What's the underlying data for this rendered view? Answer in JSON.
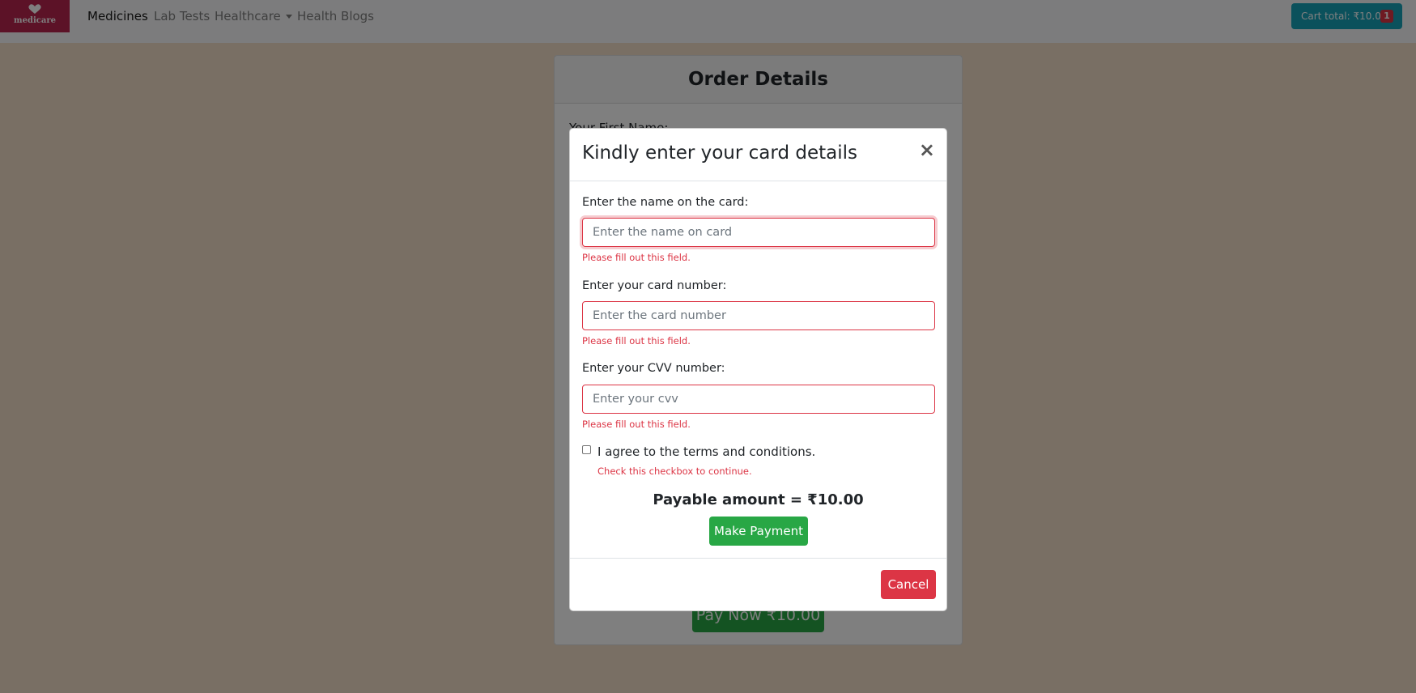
{
  "brand": {
    "logo_text": "medicare",
    "logo_color": "#b8244f"
  },
  "nav": {
    "items": [
      {
        "label": "Medicines"
      },
      {
        "label": "Lab Tests"
      },
      {
        "label": "Healthcare"
      },
      {
        "label": "Health Blogs"
      }
    ],
    "cart": {
      "label": "Cart total: ₹10.00",
      "badge": "1"
    }
  },
  "order": {
    "title": "Order Details",
    "first_name_label": "Your First Name:",
    "pay_now_label": "Pay Now ₹10.00"
  },
  "modal": {
    "title": "Kindly enter your card details",
    "close_symbol": "×",
    "name_field": {
      "label": "Enter the name on the card:",
      "placeholder": "Enter the name on card",
      "error": "Please fill out this field."
    },
    "card_field": {
      "label": "Enter your card number:",
      "placeholder": "Enter the card number",
      "error": "Please fill out this field."
    },
    "cvv_field": {
      "label": "Enter your CVV number:",
      "placeholder": "Enter your cvv",
      "error": "Please fill out this field."
    },
    "terms": {
      "label": "I agree to the terms and conditions.",
      "error": "Check this checkbox to continue."
    },
    "payable": "Payable amount = ₹10.00",
    "make_payment_label": "Make Payment",
    "cancel_label": "Cancel"
  },
  "colors": {
    "success": "#28a745",
    "danger": "#dc3545",
    "info": "#17a2b8"
  }
}
